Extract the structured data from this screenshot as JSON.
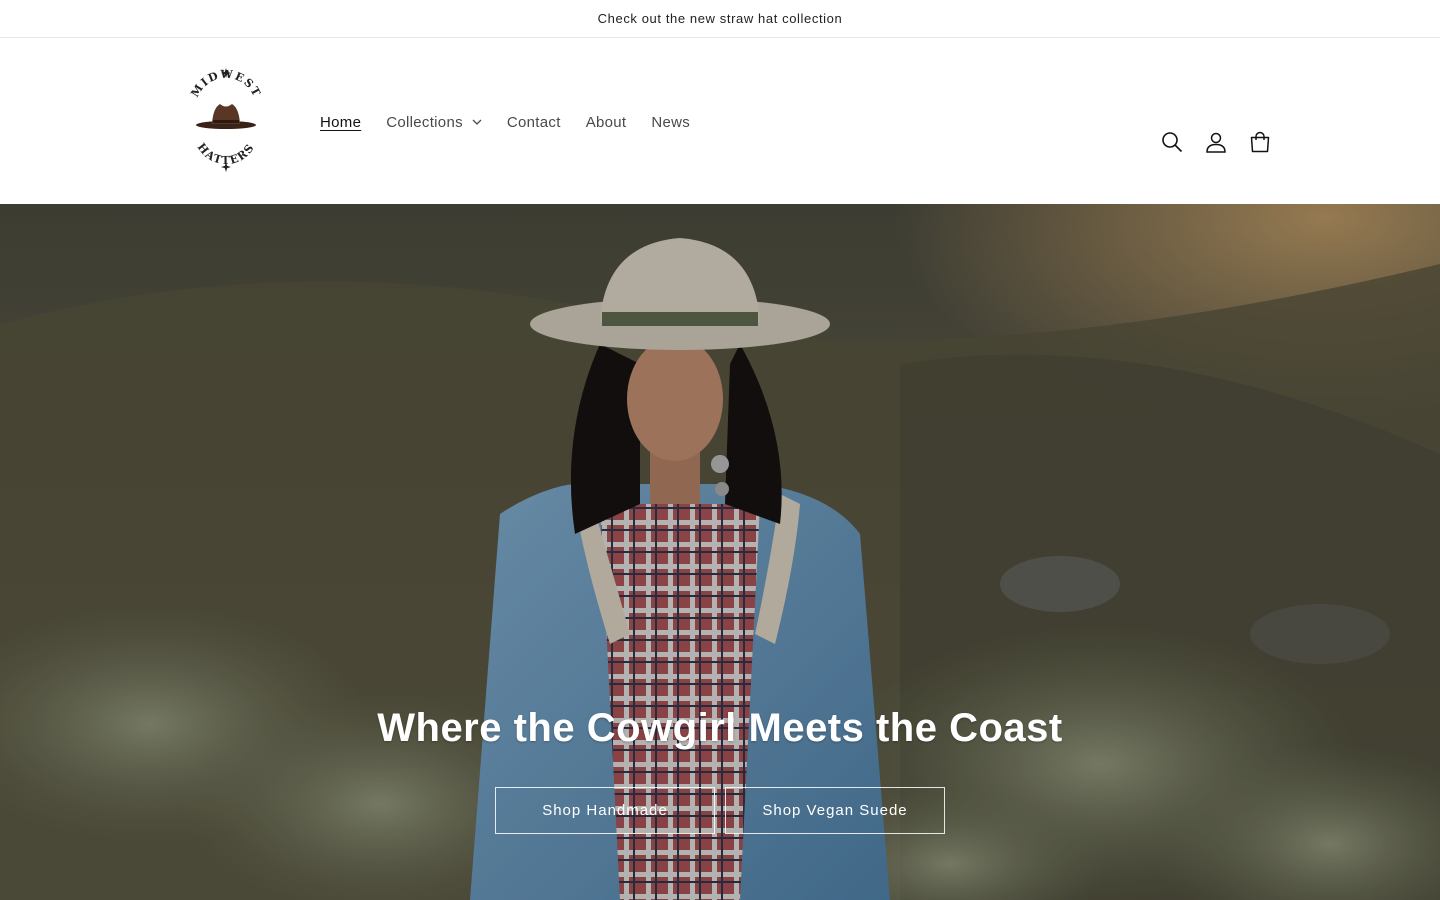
{
  "announcement": {
    "text": "Check out the new straw hat collection"
  },
  "logo": {
    "top_text": "MIDWEST",
    "bottom_text": "HATTERS",
    "icon": "cowboy-hat-logo"
  },
  "nav": {
    "items": [
      {
        "label": "Home",
        "active": true
      },
      {
        "label": "Collections",
        "has_dropdown": true
      },
      {
        "label": "Contact"
      },
      {
        "label": "About"
      },
      {
        "label": "News"
      }
    ]
  },
  "header_icons": [
    "search-icon",
    "account-icon",
    "cart-icon"
  ],
  "hero": {
    "heading": "Where the Cowgirl Meets the Coast",
    "buttons": [
      {
        "label": "Shop Handmade"
      },
      {
        "label": "Shop Vegan Suede"
      }
    ]
  },
  "colors": {
    "text": "#121212",
    "nav_text": "#4a4a4a",
    "border": "#e6e6e6",
    "hero_overlay": "#000000"
  }
}
